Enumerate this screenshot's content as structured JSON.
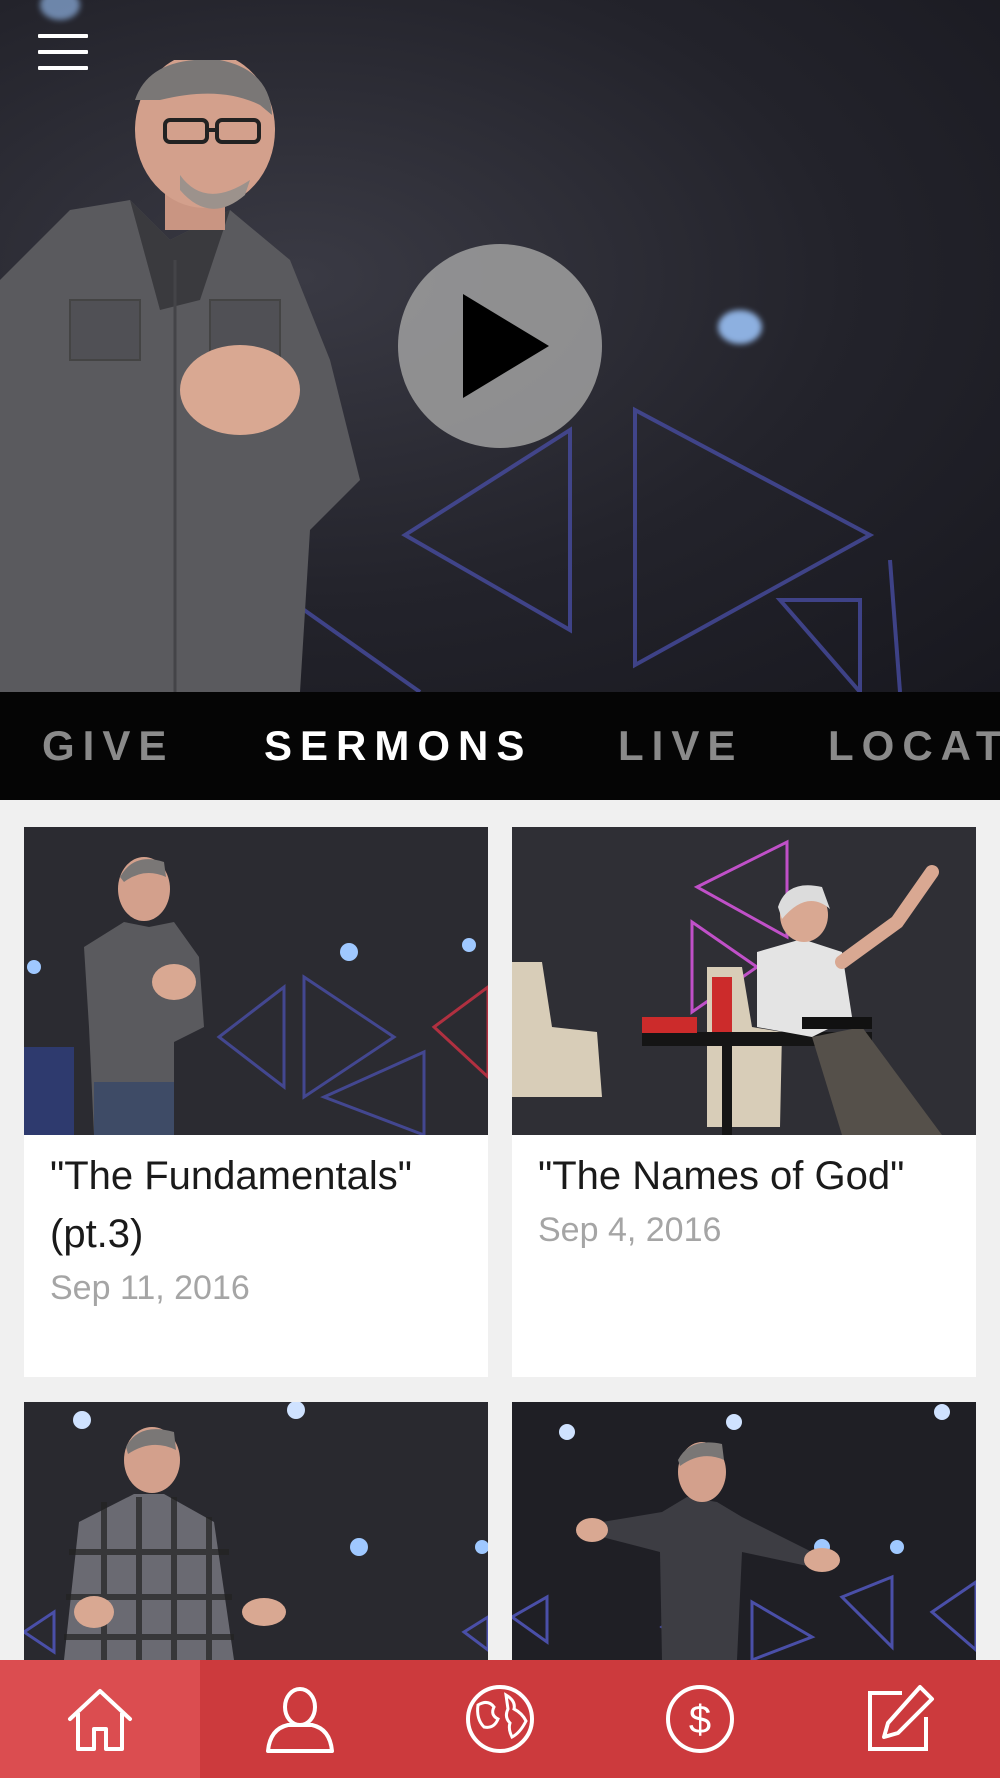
{
  "hero": {
    "menu_icon": "hamburger-menu-icon",
    "play_icon": "play-icon"
  },
  "tabs": [
    {
      "label": "GIVE",
      "active": false
    },
    {
      "label": "SERMONS",
      "active": true
    },
    {
      "label": "LIVE",
      "active": false
    },
    {
      "label": "LOCAT",
      "active": false
    }
  ],
  "sermons": [
    {
      "title": "\"The Fundamentals\" (pt.3)",
      "date": "Sep 11, 2016"
    },
    {
      "title": "\"The Names of God\"",
      "date": "Sep 4, 2016"
    },
    {
      "title": "",
      "date": ""
    },
    {
      "title": "",
      "date": ""
    }
  ],
  "bottom_nav": [
    {
      "icon": "home-icon",
      "active": true
    },
    {
      "icon": "person-icon",
      "active": false
    },
    {
      "icon": "globe-icon",
      "active": false
    },
    {
      "icon": "dollar-icon",
      "active": false
    },
    {
      "icon": "edit-icon",
      "active": false
    }
  ],
  "colors": {
    "accent": "#cc3a3d",
    "accent_active": "#db4d50",
    "tab_bar": "#050505",
    "tab_active": "#ffffff",
    "tab_inactive": "#8a8a8a",
    "date_text": "#a5a5a5"
  }
}
